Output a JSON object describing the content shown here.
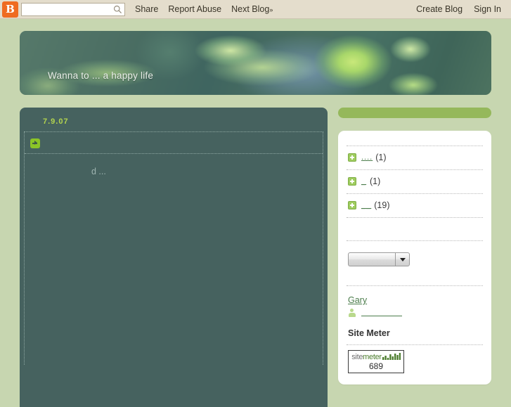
{
  "navbar": {
    "logo_letter": "B",
    "search": {
      "value": "",
      "placeholder": ""
    },
    "links": [
      {
        "label": "Share"
      },
      {
        "label": "Report Abuse"
      },
      {
        "label": "Next Blog",
        "suffix": "»"
      }
    ],
    "right_links": [
      {
        "label": "Create Blog"
      },
      {
        "label": "Sign In"
      }
    ]
  },
  "header": {
    "title": "Wanna to ... a happy life"
  },
  "post": {
    "date": "7.9.07",
    "title": "",
    "body": "d ..."
  },
  "sidebar": {
    "archive": [
      {
        "label": "....",
        "count": "(1)"
      },
      {
        "label": "_",
        "count": "(1)"
      },
      {
        "label": "__",
        "count": "(19)"
      }
    ],
    "select": {
      "value": ""
    },
    "profile": {
      "name": "Gary",
      "link_label": ""
    },
    "sitemeter": {
      "title": "Site Meter",
      "brand_first": "site",
      "brand_second": "meter",
      "count": "689"
    }
  },
  "colors": {
    "page_bg": "#c7d6b0",
    "navbar_bg": "#e4ddcc",
    "main_bg": "#46625f",
    "accent_green": "#95b85b",
    "date_green": "#b3d44e",
    "link_green": "#4c7d4c",
    "logo_orange": "#ef6b21"
  }
}
